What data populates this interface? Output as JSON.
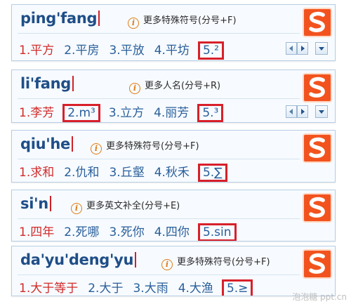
{
  "panels": [
    {
      "pinyin": "ping'fang",
      "hint": "更多特殊符号(分号+F)",
      "candidates": [
        "1.平方",
        "2.平房",
        "3.平放",
        "4.平坊",
        "5.²"
      ],
      "highlighted": [
        5
      ]
    },
    {
      "pinyin": "li'fang",
      "hint": "更多人名(分号+R)",
      "candidates": [
        "1.李芳",
        "2.m³",
        "3.立方",
        "4.丽芳",
        "5.³"
      ],
      "highlighted": [
        2,
        5
      ]
    },
    {
      "pinyin": "qiu'he",
      "hint": "更多特殊符号(分号+F)",
      "candidates": [
        "1.求和",
        "2.仇和",
        "3.丘壑",
        "4.秋禾",
        "5.∑"
      ],
      "highlighted": [
        5
      ]
    },
    {
      "pinyin": "si'n",
      "hint": "更多英文补全(分号+E)",
      "candidates": [
        "1.四年",
        "2.死哪",
        "3.死你",
        "4.四你",
        "5.sin"
      ],
      "highlighted": [
        5
      ]
    },
    {
      "pinyin": "da'yu'deng'yu",
      "hint": "更多特殊符号(分号+F)",
      "candidates": [
        "1.大于等于",
        "2.大于",
        "3.大雨",
        "4.大渔",
        "5.≥"
      ],
      "highlighted": [
        5
      ]
    }
  ],
  "icons": {
    "hint": "info-icon",
    "logo": "sogou-s-logo-icon",
    "prev": "arrow-left-icon",
    "next": "arrow-right-icon",
    "menu": "chevron-down-icon"
  },
  "watermark": "泡泡糖 ppt.cn",
  "colors": {
    "pinyin": "#1f4e87",
    "candidate": "#2a5f9a",
    "first_candidate": "#d22b2b",
    "highlight_box": "#d8202a",
    "logo": "#f2531e"
  }
}
